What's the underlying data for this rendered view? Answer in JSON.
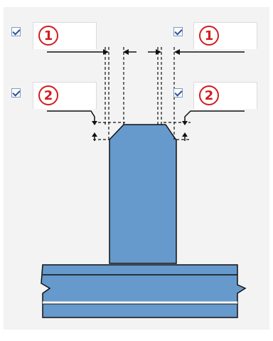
{
  "weld_options": {
    "left_top": {
      "checked": true,
      "badge": "1"
    },
    "right_top": {
      "checked": true,
      "badge": "1"
    },
    "left_bottom": {
      "checked": true,
      "badge": "2"
    },
    "right_bottom": {
      "checked": true,
      "badge": "2"
    }
  },
  "colors": {
    "badge_red": "#d11e1e",
    "plate_blue": "#6699cc",
    "panel_bg": "#f3f3f3"
  },
  "icons": [
    "checkbox-checked",
    "numbered-circle-badge",
    "dimension-arrow"
  ]
}
